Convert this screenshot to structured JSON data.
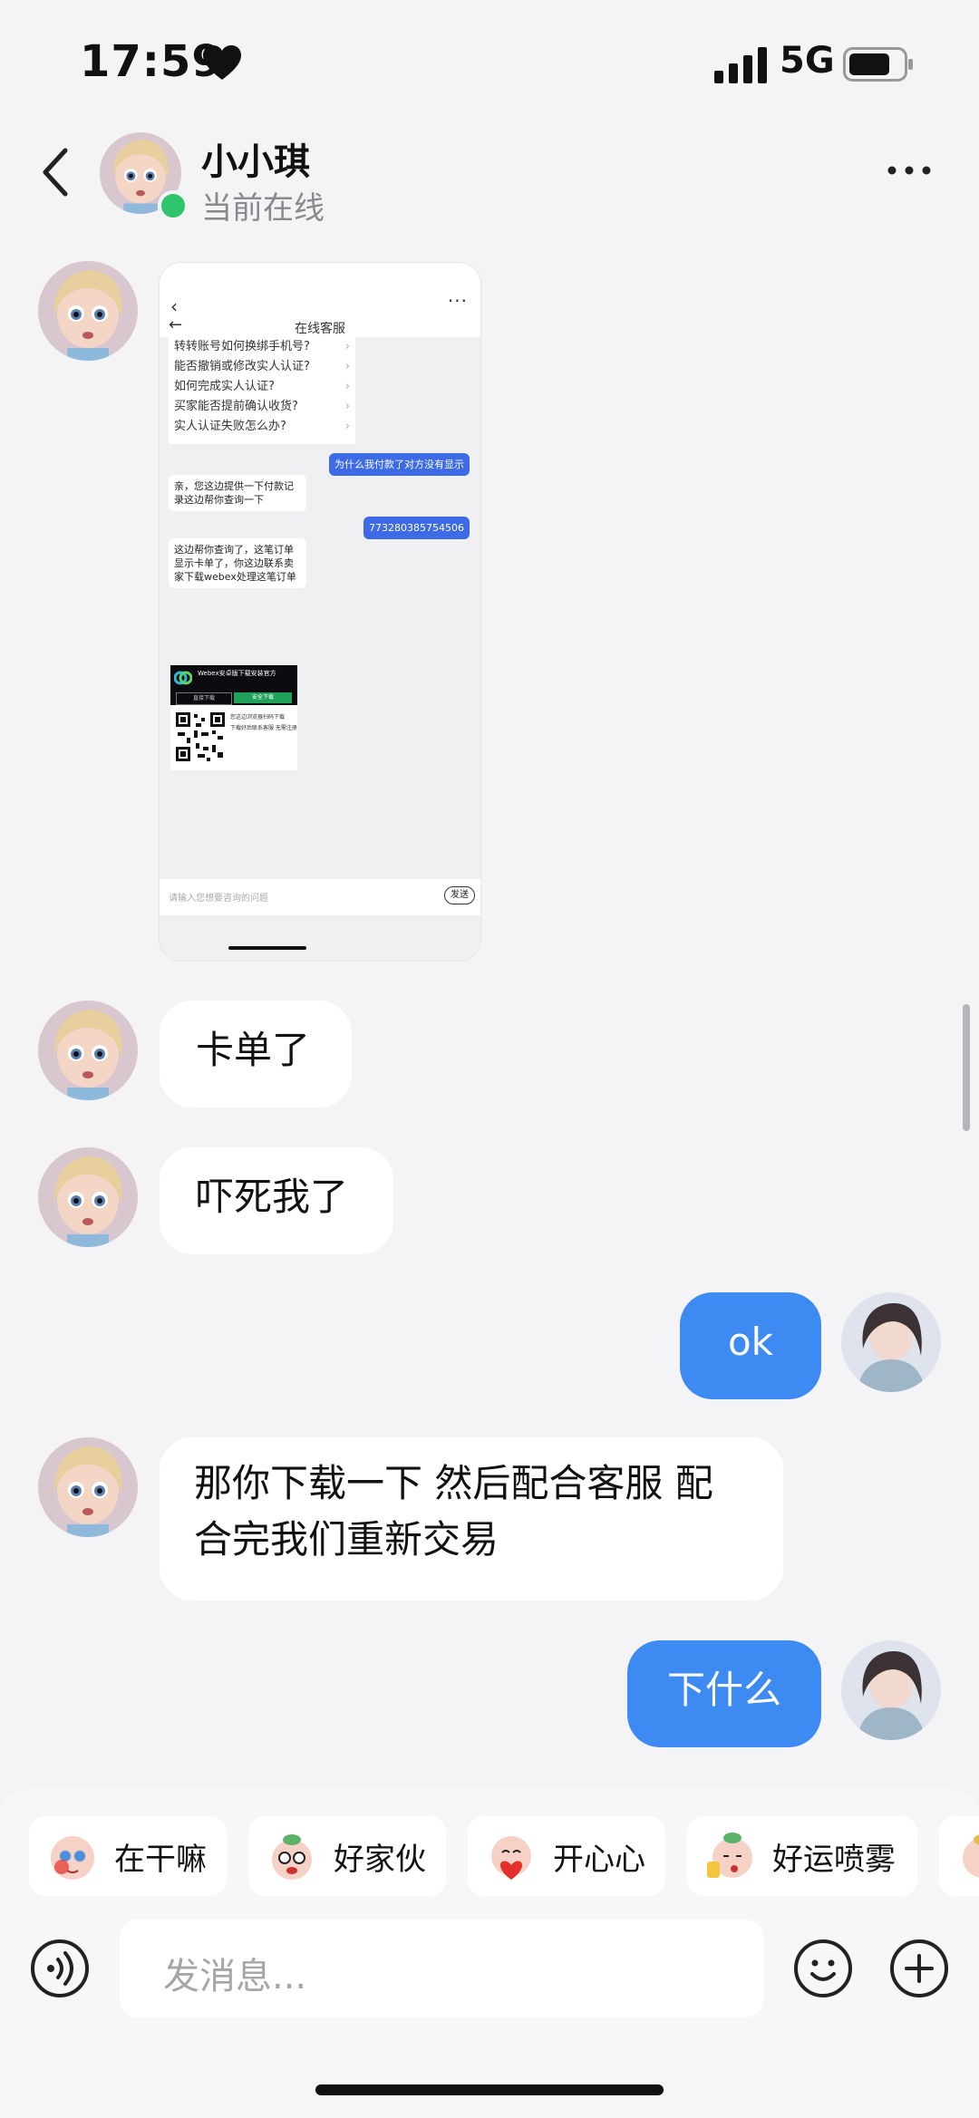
{
  "status_bar": {
    "time": "17:59",
    "network": "5G"
  },
  "header": {
    "name": "小小琪",
    "status": "当前在线"
  },
  "screenshot_card": {
    "title": "在线客服",
    "faq": [
      "转转账号如何换绑手机号?",
      "能否撤销或修改实人认证?",
      "如何完成实人认证?",
      "买家能否提前确认收货?",
      "实人认证失败怎么办?"
    ],
    "msg_user_1": "为什么我付款了对方没有显示",
    "msg_kf_1": "亲，您这边提供一下付款记录这边帮你查询一下",
    "msg_user_2": "773280385754506",
    "msg_kf_2": "这边帮你查询了，这笔订单显示卡单了，你这边联系卖家下载webex处理这笔订单",
    "qr_title": "Webex安卓版下载安装官方",
    "qr_btn_1": "直接下载",
    "qr_btn_2": "安全下载",
    "qr_text_1": "您这边浏览器扫码下载",
    "qr_text_2": "下载好后联系客服 无需注册",
    "input_placeholder": "请输入您想要咨询的问题",
    "send": "发送"
  },
  "messages": [
    {
      "side": "in",
      "text": "卡单了"
    },
    {
      "side": "in",
      "text": "吓死我了"
    },
    {
      "side": "out",
      "text": "ok"
    },
    {
      "side": "in",
      "text": "那你下载一下 然后配合客服 配合完我们重新交易"
    },
    {
      "side": "out",
      "text": "下什么"
    }
  ],
  "stickers": [
    "在干嘛",
    "好家伙",
    "开心心",
    "好运喷雾"
  ],
  "composer": {
    "placeholder": "发消息..."
  },
  "colors": {
    "accent": "#3d8bf2",
    "online": "#2fc56b",
    "background": "#f4f4f6"
  }
}
